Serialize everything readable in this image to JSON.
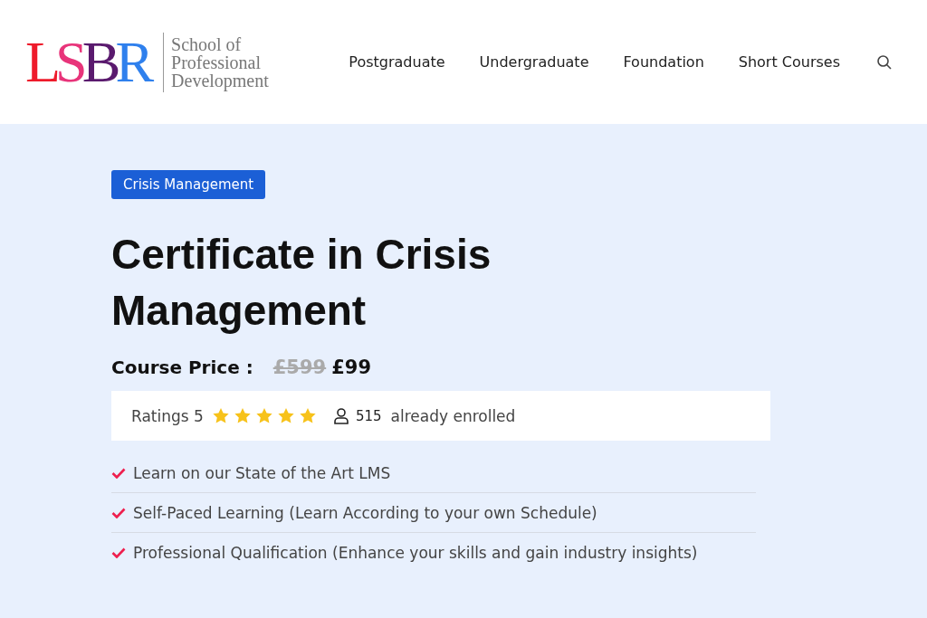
{
  "logo": {
    "letters": [
      {
        "text": "L",
        "color": "#ee1b2b"
      },
      {
        "text": "S",
        "color": "#e8347a"
      },
      {
        "text": "B",
        "color": "#5a1a6e"
      },
      {
        "text": "R",
        "color": "#2f80ed"
      }
    ],
    "tagline": [
      "School of",
      "Professional",
      "Development"
    ]
  },
  "nav": [
    "Postgraduate",
    "Undergraduate",
    "Foundation",
    "Short Courses"
  ],
  "category": "Crisis Management",
  "title": "Certificate in Crisis Management",
  "price": {
    "label": "Course Price :",
    "old": "£599",
    "current": "£99"
  },
  "ratings": {
    "label": "Ratings 5",
    "stars": 5,
    "enrolled_count": "515",
    "enrolled_label": "already enrolled"
  },
  "features": [
    "Learn on our State of the Art LMS",
    "Self-Paced Learning (Learn According to your own Schedule)",
    "Professional Qualification (Enhance your skills and gain industry insights)"
  ]
}
